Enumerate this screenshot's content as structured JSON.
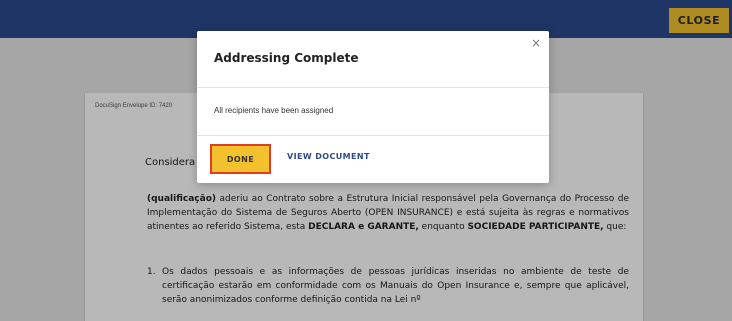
{
  "header": {
    "close_label": "CLOSE",
    "colors": {
      "bar": "#2c4a8c",
      "accent": "#f2c230"
    }
  },
  "document": {
    "envelope_id": "DocuSign Envelope ID: 7420",
    "consider_text": "Considera",
    "paragraph": {
      "bold_start": "(qualificação)",
      "text_1": " aderiu ao Contrato sobre a Estrutura Inicial responsável pela Governança do Processo de Implementação do Sistema de Seguros Aberto (OPEN INSURANCE) e está sujeita às regras e normativos atinentes ao referido Sistema, esta ",
      "bold_mid": "DECLARA e GARANTE,",
      "text_2": " enquanto ",
      "bold_end": "SOCIEDADE PARTICIPANTE,",
      "text_3": " que:"
    },
    "list_item_1": {
      "number": "1.",
      "text": "Os dados pessoais e as informações de pessoas jurídicas inseridas no ambiente de teste de certificação estarão em conformidade com os Manuais do Open Insurance e, sempre que aplicável, serão anonimizados conforme definição contida na Lei nº"
    }
  },
  "modal": {
    "title": "Addressing Complete",
    "close_icon": "×",
    "body": "All recipients have been assigned",
    "done_label": "DONE",
    "view_label": "VIEW DOCUMENT",
    "colors": {
      "done_bg": "#f4c12e",
      "done_border": "#e23b22",
      "link": "#2c4a8c"
    }
  }
}
